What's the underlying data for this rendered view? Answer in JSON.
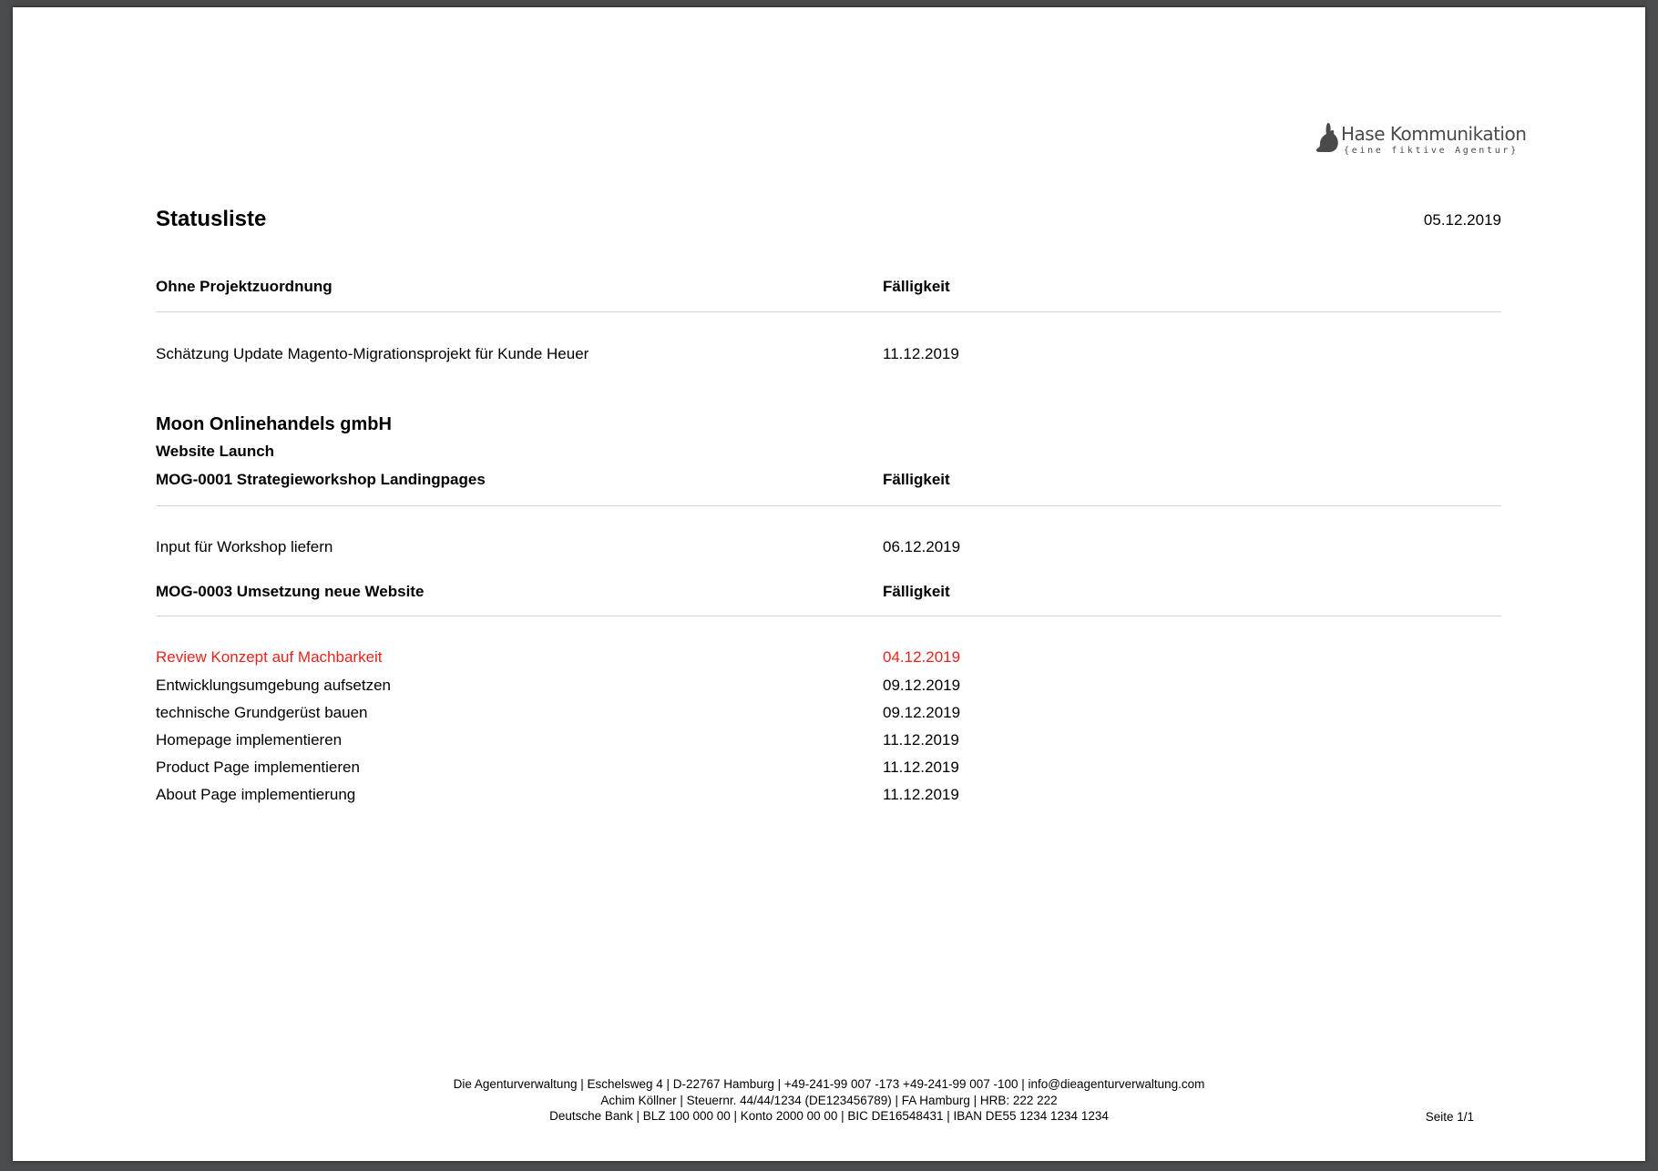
{
  "header": {
    "logo": {
      "name": "Hase Kommunikation",
      "tagline": "{eine fiktive Agentur}",
      "icon": "rabbit-icon",
      "color": "#4a4a4a"
    },
    "title": "Statusliste",
    "date": "05.12.2019"
  },
  "sections": {
    "unassigned": {
      "heading": "Ohne Projektzuordnung",
      "due_heading": "Fälligkeit",
      "tasks": [
        {
          "name": "Schätzung Update Magento-Migrationsprojekt für Kunde Heuer",
          "due": "11.12.2019"
        }
      ]
    },
    "client": {
      "name": "Moon Onlinehandels gmbH",
      "project": "Website Launch",
      "jobs": [
        {
          "heading": "MOG-0001 Strategieworkshop Landingpages",
          "due_heading": "Fälligkeit",
          "tasks": [
            {
              "name": "Input für Workshop liefern",
              "due": "06.12.2019"
            }
          ]
        },
        {
          "heading": "MOG-0003 Umsetzung neue Website",
          "due_heading": "Fälligkeit",
          "tasks": [
            {
              "name": "Review Konzept auf Machbarkeit",
              "due": "04.12.2019",
              "overdue": true
            },
            {
              "name": "Entwicklungsumgebung aufsetzen",
              "due": "09.12.2019"
            },
            {
              "name": "technische Grundgerüst bauen",
              "due": "09.12.2019"
            },
            {
              "name": "Homepage implementieren",
              "due": "11.12.2019"
            },
            {
              "name": "Product Page implementieren",
              "due": "11.12.2019"
            },
            {
              "name": "About Page implementierung",
              "due": "11.12.2019"
            }
          ]
        }
      ]
    }
  },
  "colors": {
    "overdue": "#e8231b",
    "rule": "#d4d4d4",
    "background": "#4a4b4d"
  },
  "footer": {
    "line1": "Die Agenturverwaltung | Eschelsweg 4 | D-22767 Hamburg | +49-241-99 007 -173 +49-241-99 007 -100 | info@dieagenturverwaltung.com",
    "line2": "Achim Köllner | Steuernr. 44/44/1234 (DE123456789) | FA Hamburg | HRB: 222 222",
    "line3": "Deutsche Bank | BLZ 100 000 00 | Konto 2000 00 00 | BIC DE16548431 | IBAN DE55 1234 1234 1234",
    "page": "Seite 1/1"
  }
}
